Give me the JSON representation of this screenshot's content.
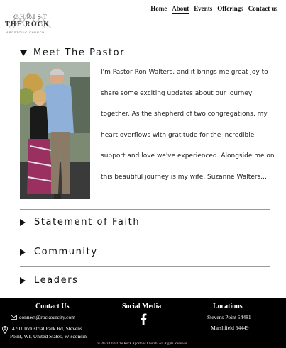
{
  "logo": {
    "line1": "CHRIST",
    "line2": "THE ROCK",
    "line3": "APOSTOLIC CHURCH"
  },
  "nav": {
    "items": [
      {
        "label": "Home",
        "active": false
      },
      {
        "label": "About",
        "active": true
      },
      {
        "label": "Events",
        "active": false
      },
      {
        "label": "Offerings",
        "active": false
      },
      {
        "label": "Contact us",
        "active": false
      }
    ]
  },
  "sections": {
    "pastor": {
      "title": "Meet The Pastor",
      "expanded": true,
      "bio_lines": [
        "I'm Pastor Ron Walters, and it brings me great joy to",
        "share some exciting updates about our journey",
        "together. As the shepherd of two congregations, my",
        "heart overflows with gratitude for the incredible",
        "support and love we've experienced. Alongside me on",
        "this beautiful journey is my wife, Suzanne Walters..."
      ]
    },
    "faith": {
      "title": "Statement of Faith",
      "expanded": false
    },
    "community": {
      "title": "Community",
      "expanded": false
    },
    "leaders": {
      "title": "Leaders",
      "expanded": false
    }
  },
  "footer": {
    "contact": {
      "title": "Contact Us",
      "email": "connect@rockourcity.com",
      "address_line1": "4701 Industrial Park Rd, Stevens",
      "address_line2": "Point, WI, United States, Wisconsin"
    },
    "social": {
      "title": "Social Media",
      "icon": "facebook-icon"
    },
    "locations": {
      "title": "Locations",
      "items": [
        "Stevens Point 54481",
        "Marshfield 54449"
      ]
    },
    "copyright": "© 2023 Christ the Rock Apostolic Church. All Rights Reserved."
  },
  "colors": {
    "footer_bg": "#000000",
    "divider": "#9a9a9a",
    "text": "#111111"
  }
}
